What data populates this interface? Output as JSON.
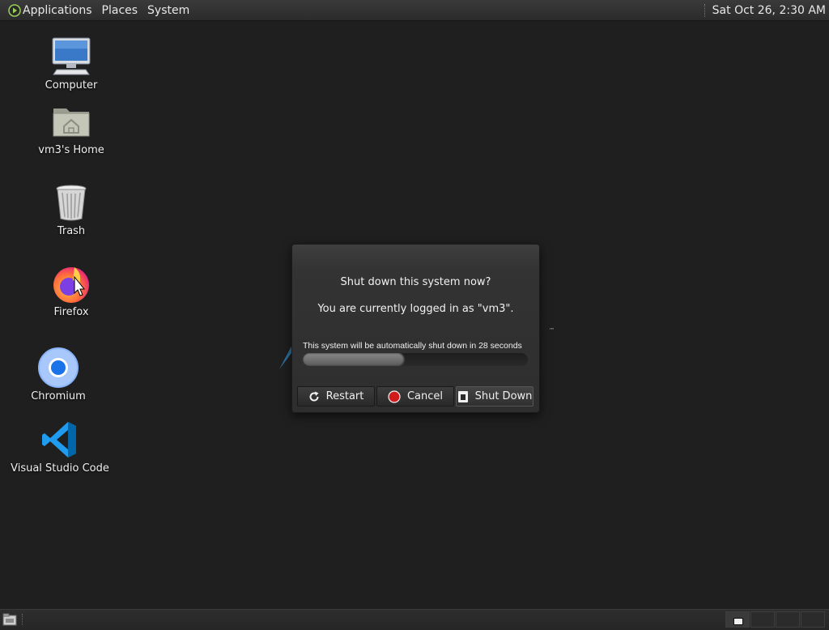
{
  "top_panel": {
    "menus": [
      "Applications",
      "Places",
      "System"
    ],
    "clock": "Sat Oct 26,  2:30 AM",
    "apps_icon": "mate-logo-icon"
  },
  "desktop_icons": [
    {
      "label": "Computer",
      "icon": "computer-icon"
    },
    {
      "label": "vm3's Home",
      "icon": "home-folder-icon"
    },
    {
      "label": "Trash",
      "icon": "trash-icon"
    },
    {
      "label": "Firefox",
      "icon": "firefox-icon"
    },
    {
      "label": "Chromium",
      "icon": "chromium-icon"
    },
    {
      "label": "Visual Studio Code",
      "icon": "vscode-icon"
    }
  ],
  "dialog": {
    "title": "Shut down this system now?",
    "message": "You are currently logged in as \"vm3\".",
    "timer_text": "This system will be automatically shut down in 28 seconds",
    "progress": 0.45,
    "buttons": {
      "restart": "Restart",
      "cancel": "Cancel",
      "shutdown": "Shut Down"
    }
  },
  "bottom_panel": {
    "workspaces": 4,
    "active_workspace": 1
  },
  "colors": {
    "desktop_bg": "#1f1f1f",
    "cancel_red": "#d11a1a",
    "chromium_blue": "#4285f4",
    "vscode_blue": "#1f9cf0"
  }
}
